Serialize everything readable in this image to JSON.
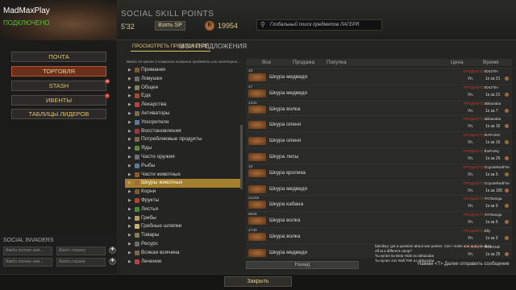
{
  "header": {
    "player_name": "MadMaxPlay",
    "status": "ПОДКЛЮЧЕНО",
    "ssp_label": "SOCIAL SKILL POINTS",
    "ssp_value": "5'32",
    "take_sp": "Взять SP",
    "coin_letter": "B",
    "money": "19954",
    "search_placeholder": "Глобальный поиск предметов ЛАГЕРЯ",
    "search_icon": "search-icon"
  },
  "menu": [
    {
      "label": "ПОЧТА",
      "active": false
    },
    {
      "label": "ТОРГОВЛЯ",
      "active": true
    },
    {
      "label": "STASH",
      "active": false,
      "badge": "36"
    },
    {
      "label": "ИВЕНТЫ",
      "active": false,
      "badge": "8"
    },
    {
      "label": "ТАБЛИЦЫ ЛИДЕРОВ",
      "active": false
    }
  ],
  "social_invaders": {
    "label": "SOCIAL INVADERS",
    "rows": [
      {
        "f1": "Введи полное имя...",
        "f2": "Введи страну"
      },
      {
        "f1": "Введи полное имя...",
        "f2": "Введи страну"
      }
    ]
  },
  "tabs": {
    "view": "ПРОСМОТРЕТЬ ПРЕДЛОЖЕНИЯ",
    "my": "МОИ ПРЕДЛОЖЕНИЯ"
  },
  "hint": "Введи не менее 2 символов названия предмета или категории...",
  "tree": [
    {
      "label": "Приманки",
      "color": "#7a5a35"
    },
    {
      "label": "Ловушки",
      "color": "#6d6d6d"
    },
    {
      "label": "Общее",
      "color": "#8a7a58"
    },
    {
      "label": "Еда",
      "color": "#a04a32"
    },
    {
      "label": "Лекарства",
      "color": "#b54242"
    },
    {
      "label": "Активаторы",
      "color": "#7a6a4a"
    },
    {
      "label": "Ускорители",
      "color": "#5a7a96"
    },
    {
      "label": "Восстановления",
      "color": "#9a3a3a"
    },
    {
      "label": "Потребляемые продукты",
      "color": "#7a6a4a"
    },
    {
      "label": "Яды",
      "color": "#5a8a3a"
    },
    {
      "label": "Части оружия",
      "color": "#6d6d6d"
    },
    {
      "label": "Рыбы",
      "color": "#5a7a96"
    },
    {
      "label": "Части животных",
      "color": "#8a5a35"
    },
    {
      "label": "Шкуры животных",
      "color": "#a46a38",
      "selected": true
    },
    {
      "label": "Корни",
      "color": "#7a5a35"
    },
    {
      "label": "Фрукты",
      "color": "#b5422e"
    },
    {
      "label": "Листья",
      "color": "#4a8a3a"
    },
    {
      "label": "Грибы",
      "color": "#b59a6a"
    },
    {
      "label": "Грибные шляпки",
      "color": "#c8b07a"
    },
    {
      "label": "Товары",
      "color": "#8a7a58"
    },
    {
      "label": "Ресурс",
      "color": "#6d6d6d"
    },
    {
      "label": "Всякая всячина",
      "color": "#7a6a4a"
    },
    {
      "label": "Лечение",
      "color": "#b54242"
    }
  ],
  "columns": [
    "Все",
    "Продажа",
    "Покупка",
    "Цена",
    "Время"
  ],
  "listings": [
    {
      "qty": "40",
      "name": "Шкура медведя",
      "sold": "ПРОДАЕТСЯ",
      "seller": "IDIUTIH",
      "price": "Уп.",
      "mid": "1к за 21"
    },
    {
      "qty": "47",
      "name": "Шкура медведя",
      "sold": "ПРОДАЕТСЯ",
      "seller": "IDIUTIH",
      "price": "Уп.",
      "mid": "1к за 21"
    },
    {
      "qty": "1331",
      "name": "Шкура волка",
      "sold": "ПРОДАЕТСЯ",
      "seller": "abbazaba",
      "price": "Уп.",
      "mid": "1к за 7"
    },
    {
      "qty": "",
      "name": "Шкура оленя",
      "sold": "ПРОДАЕТСЯ",
      "seller": "abbazaba",
      "price": "Уп.",
      "mid": "1к за 16"
    },
    {
      "qty": "",
      "name": "Шкура оленя",
      "sold": "ПРОДАЕТСЯ",
      "seller": "RAPUSO",
      "price": "Уп.",
      "mid": "1к за 15"
    },
    {
      "qty": "",
      "name": "Шкура лисы",
      "sold": "ПРОДАЕТСЯ",
      "seller": "thePorky",
      "price": "Уп.",
      "mid": "1к за 25"
    },
    {
      "qty": "10",
      "name": "Шкура кролика",
      "sold": "ПРОДАЕТСЯ",
      "seller": "CoyoteRedFire",
      "price": "Уп.",
      "mid": "1к за 5"
    },
    {
      "qty": "",
      "name": "Шкура медведя",
      "sold": "ПРОДАЕТСЯ",
      "seller": "CoyoteRedFire",
      "price": "Уп.",
      "mid": "1к за 100"
    },
    {
      "qty": "21416",
      "name": "Шкура кабана",
      "sold": "ПРОДАЕТСЯ",
      "seller": "YOTamiga",
      "price": "Уп.",
      "mid": "1к за 6"
    },
    {
      "qty": "6945",
      "name": "Шкура волка",
      "sold": "ПРОДАЕТСЯ",
      "seller": "YOTamiga",
      "price": "Уп.",
      "mid": "1к за 6"
    },
    {
      "qty": "4740",
      "name": "Шкура волка",
      "sold": "ПРОДАЕТСЯ",
      "seller": "Elly",
      "price": "Уп.",
      "mid": "1к за 5"
    },
    {
      "qty": "",
      "name": "Шкура медведя",
      "sold": "ПРОДАЕТСЯ",
      "seller": "ROLAND",
      "price": "Уп.",
      "mid": "1к за 25"
    }
  ],
  "chat": [
    "fatmikey: got a question about war parties. Can i make one and join them",
    "off at a different camp?",
    "Ты купил 5х Bear Hide из abbazaba",
    "Ты купил 44х Wolf Pelt из abbazaba"
  ],
  "back_label": "Назад",
  "chat_input": "Нажми <T> Далее отправить сообщение",
  "close_label": "Закрыть"
}
